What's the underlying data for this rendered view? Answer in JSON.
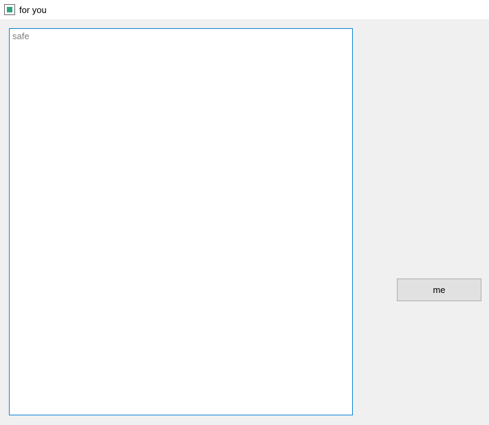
{
  "window": {
    "title": "for you"
  },
  "main": {
    "textarea_value": "",
    "textarea_placeholder": "safe"
  },
  "buttons": {
    "side_label": "me"
  }
}
